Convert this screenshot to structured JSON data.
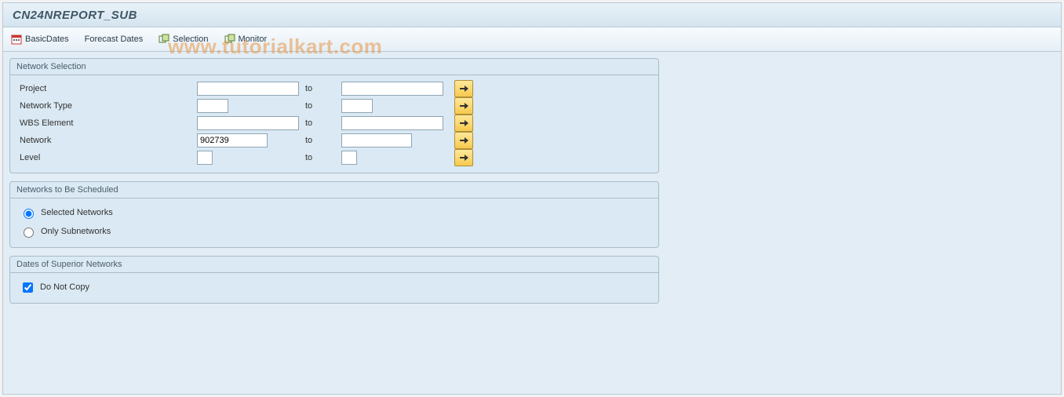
{
  "title": "CN24NREPORT_SUB",
  "toolbar": {
    "basic_dates": "BasicDates",
    "forecast_dates": "Forecast Dates",
    "selection": "Selection",
    "monitor": "Monitor"
  },
  "watermark": "www.tutorialkart.com",
  "group_network_selection": {
    "title": "Network Selection",
    "to_label": "to",
    "rows": {
      "project": {
        "label": "Project",
        "from": "",
        "to": ""
      },
      "network_type": {
        "label": "Network Type",
        "from": "",
        "to": ""
      },
      "wbs_element": {
        "label": "WBS Element",
        "from": "",
        "to": ""
      },
      "network": {
        "label": "Network",
        "from": "902739",
        "to": ""
      },
      "level": {
        "label": "Level",
        "from": "",
        "to": ""
      }
    }
  },
  "group_schedule": {
    "title": "Networks to Be Scheduled",
    "opt_selected": "Selected Networks",
    "opt_subnet": "Only Subnetworks",
    "value": "selected"
  },
  "group_superior": {
    "title": "Dates of Superior Networks",
    "chk_label": "Do Not Copy",
    "chk_value": true
  }
}
